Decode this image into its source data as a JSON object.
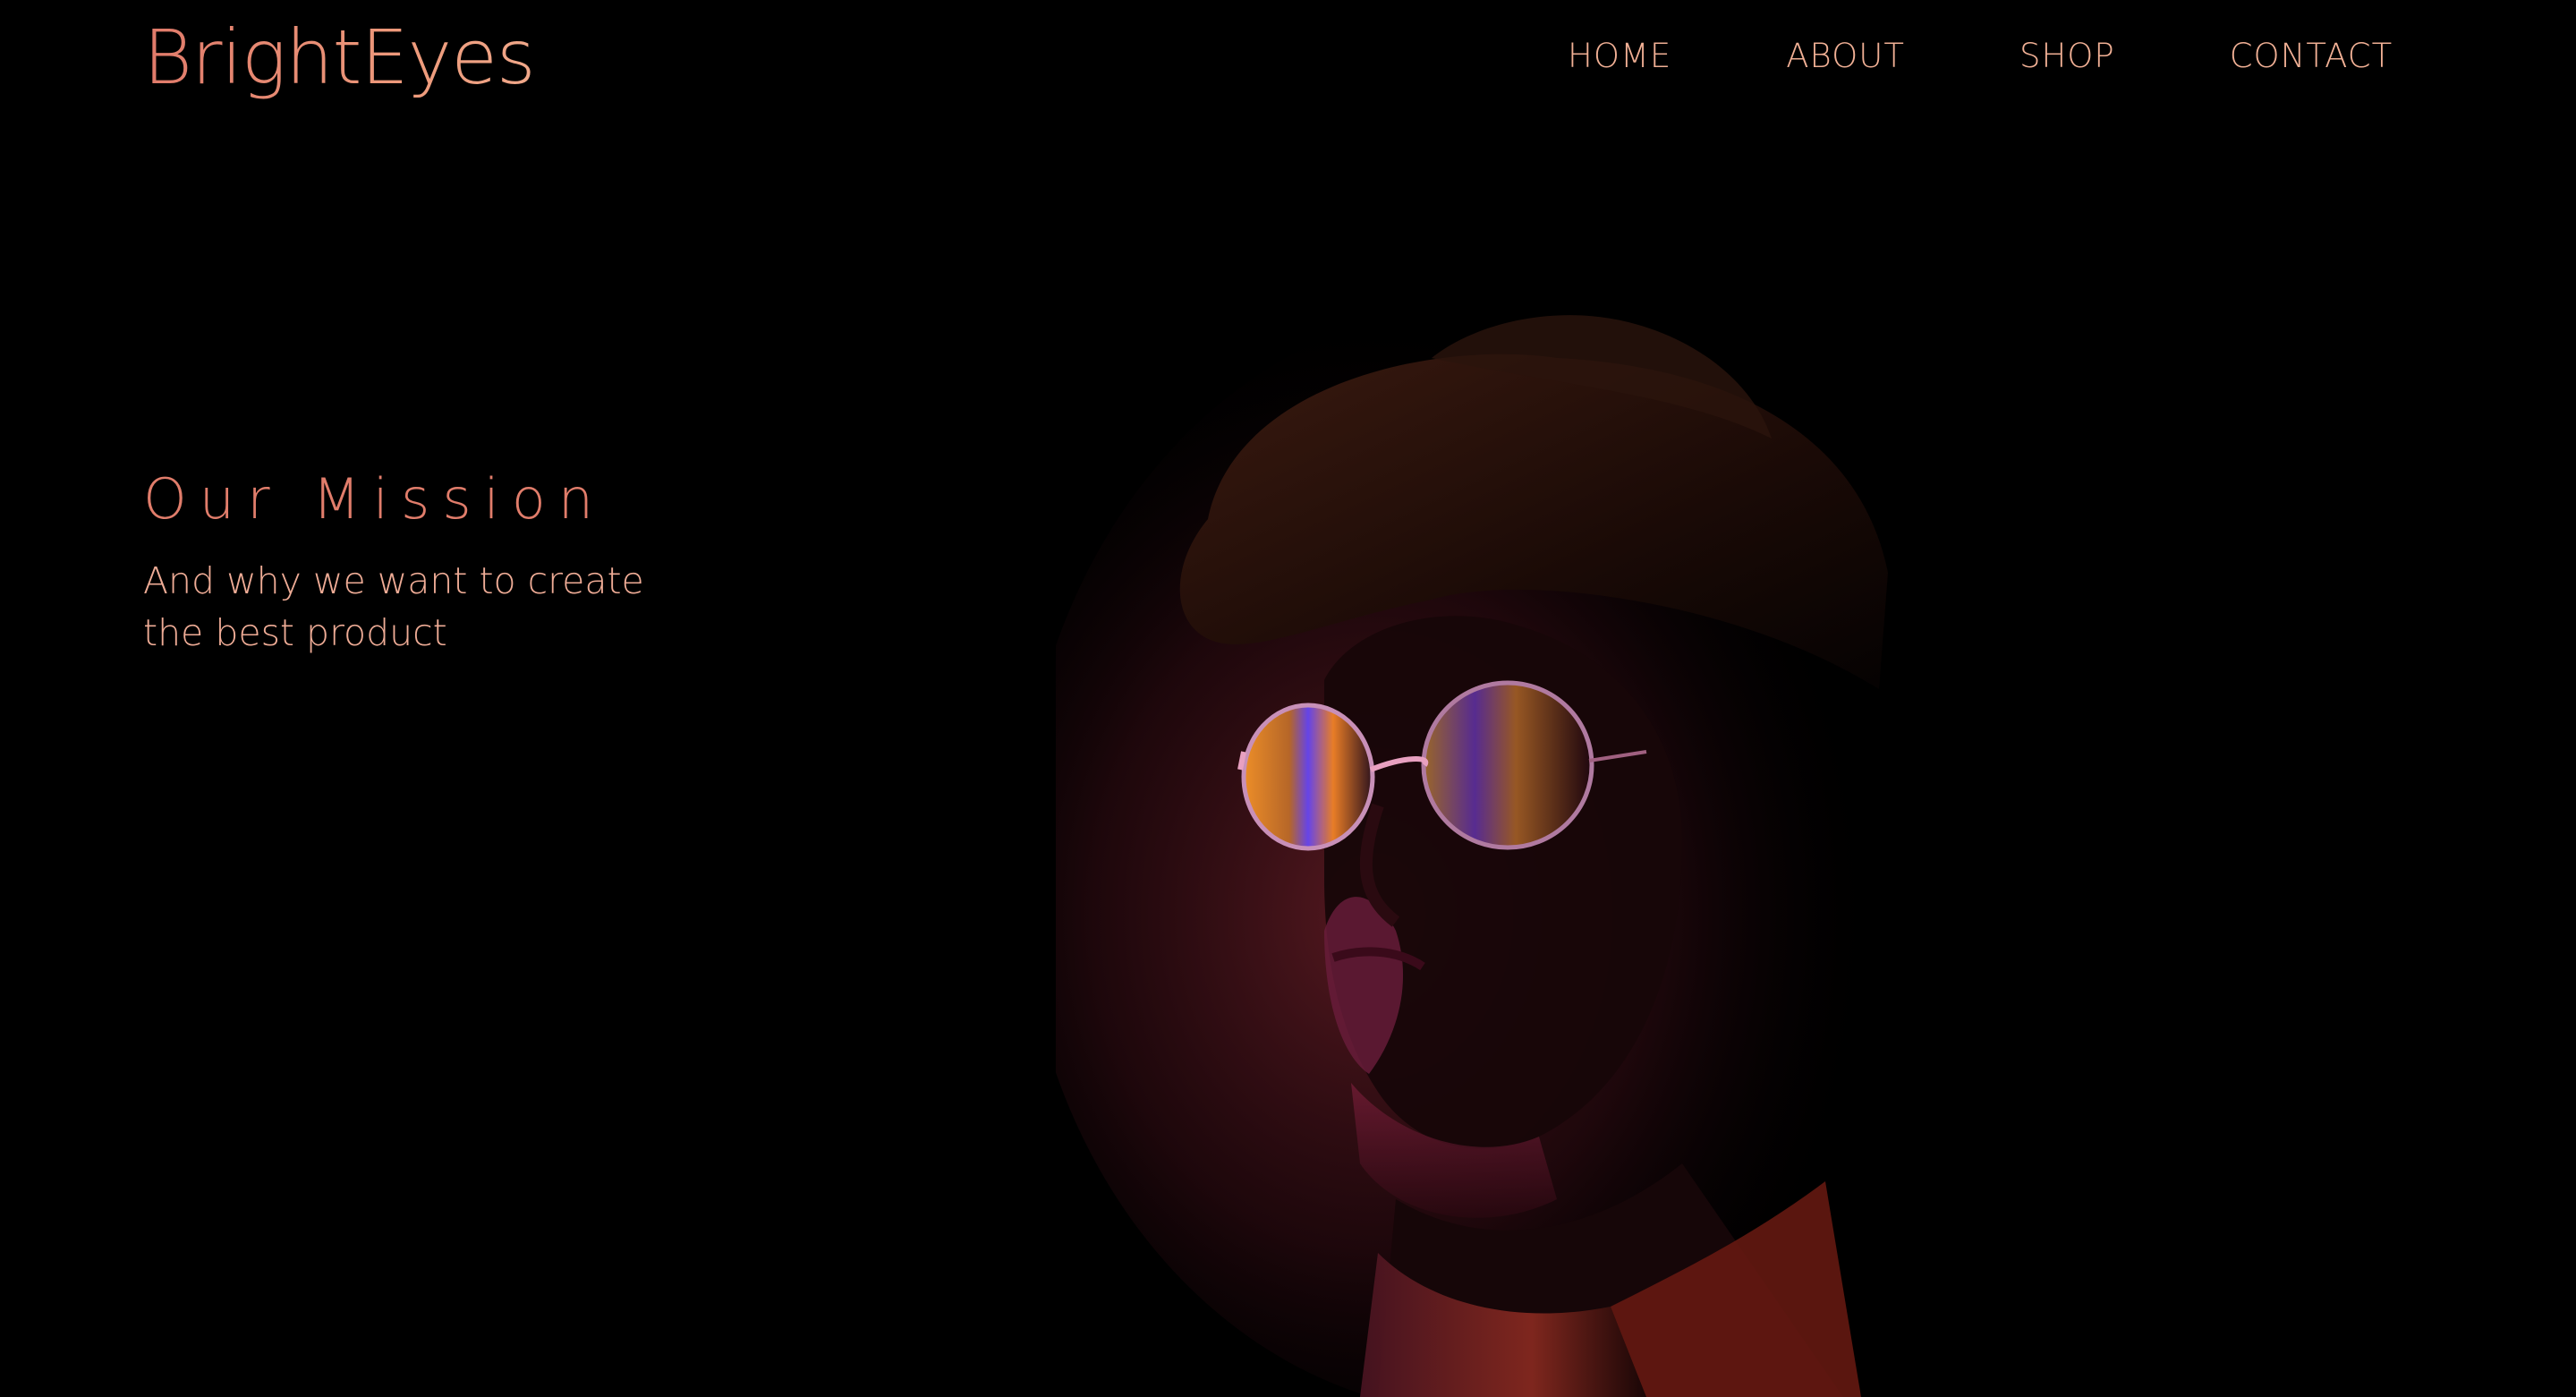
{
  "brand": {
    "logo_text": "BrightEyes",
    "accent_color": "#e17d6b",
    "nav_text_color": "#f1b095"
  },
  "nav": {
    "items": [
      {
        "label": "HOME"
      },
      {
        "label": "ABOUT"
      },
      {
        "label": "SHOP"
      },
      {
        "label": "CONTACT"
      }
    ]
  },
  "hero": {
    "title": "Our Mission",
    "subtitle": "And why we want to create the best product",
    "background_color": "#000000"
  }
}
